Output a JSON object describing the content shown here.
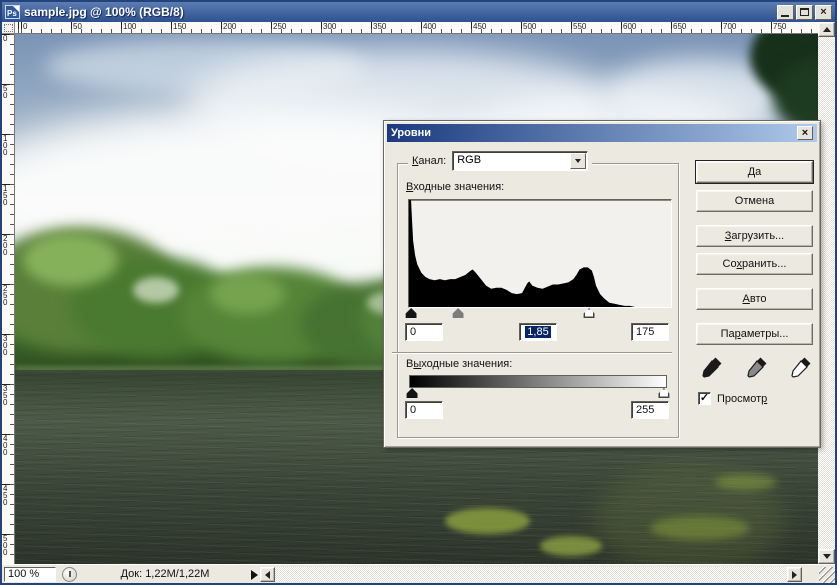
{
  "window": {
    "title": "sample.jpg @ 100% (RGB/8)",
    "app_icon": "photoshop-ps-icon",
    "controls": [
      "minimize",
      "maximize",
      "close"
    ]
  },
  "rulers": {
    "top_labels": [
      "0",
      "50",
      "100",
      "150",
      "200",
      "250",
      "300",
      "350",
      "400",
      "450",
      "500",
      "550",
      "600",
      "650",
      "700",
      "750"
    ],
    "left_labels": [
      "0",
      "50",
      "100",
      "150",
      "200",
      "250",
      "300",
      "350",
      "400",
      "450",
      "500"
    ]
  },
  "dialog": {
    "title": "Уровни",
    "close_label": "×",
    "channel": {
      "label": {
        "text": "Канал:",
        "u": 0
      },
      "value": "RGB"
    },
    "input_section": {
      "label": {
        "text": "Входные значения:",
        "u": 0
      },
      "black": "0",
      "gamma": "1,85",
      "white": "175"
    },
    "output_section": {
      "label": {
        "text": "Выходные значения:",
        "u": 1
      },
      "black": "0",
      "white": "255"
    },
    "sliders": {
      "input_black": 0.012,
      "input_gamma": 0.19,
      "input_white": 0.686,
      "output_black": 0.012,
      "output_white": 0.988
    },
    "histogram": {
      "type": "histogram",
      "channel": "RGB",
      "x_range": [
        0,
        255
      ],
      "points": [
        [
          0,
          100
        ],
        [
          2,
          100
        ],
        [
          3,
          80
        ],
        [
          4,
          62
        ],
        [
          6,
          48
        ],
        [
          8,
          40
        ],
        [
          12,
          32
        ],
        [
          16,
          28
        ],
        [
          20,
          26
        ],
        [
          25,
          25
        ],
        [
          30,
          26
        ],
        [
          35,
          25
        ],
        [
          40,
          26
        ],
        [
          45,
          26
        ],
        [
          50,
          28
        ],
        [
          55,
          30
        ],
        [
          60,
          34
        ],
        [
          62,
          35
        ],
        [
          65,
          32
        ],
        [
          70,
          26
        ],
        [
          75,
          20
        ],
        [
          80,
          17
        ],
        [
          85,
          18
        ],
        [
          90,
          18
        ],
        [
          95,
          16
        ],
        [
          100,
          13
        ],
        [
          105,
          12
        ],
        [
          110,
          13
        ],
        [
          115,
          22
        ],
        [
          117,
          24
        ],
        [
          120,
          20
        ],
        [
          125,
          18
        ],
        [
          130,
          17
        ],
        [
          135,
          19
        ],
        [
          140,
          21
        ],
        [
          145,
          21
        ],
        [
          150,
          22
        ],
        [
          155,
          23
        ],
        [
          160,
          26
        ],
        [
          163,
          30
        ],
        [
          166,
          35
        ],
        [
          170,
          37
        ],
        [
          174,
          37
        ],
        [
          178,
          34
        ],
        [
          180,
          28
        ],
        [
          182,
          20
        ],
        [
          186,
          12
        ],
        [
          190,
          8
        ],
        [
          195,
          4
        ],
        [
          200,
          3
        ],
        [
          205,
          2
        ],
        [
          210,
          1
        ],
        [
          215,
          1
        ],
        [
          220,
          0
        ],
        [
          255,
          0
        ]
      ]
    },
    "buttons": [
      {
        "name": "ok",
        "label": "Да",
        "u": -1,
        "default": true
      },
      {
        "name": "cancel",
        "label": "Отмена",
        "u": -1
      },
      {
        "name": "load",
        "label": "Загрузить...",
        "u": 0
      },
      {
        "name": "save",
        "label": "Сохранить...",
        "u": 2
      },
      {
        "name": "auto",
        "label": "Авто",
        "u": 0
      },
      {
        "name": "options",
        "label": "Параметры...",
        "u": 2
      }
    ],
    "eyedroppers": [
      {
        "name": "black-point-eyedropper",
        "tip": "#1a1a1a"
      },
      {
        "name": "gray-point-eyedropper",
        "tip": "#8a8a8a"
      },
      {
        "name": "white-point-eyedropper",
        "tip": "#ffffff"
      }
    ],
    "preview": {
      "label": {
        "text": "Просмотр",
        "u": 7
      },
      "checked": true,
      "check_glyph": "✓"
    }
  },
  "statusbar": {
    "zoom_value": "100 %",
    "doc_label": "Док: 1,22М/1,22М",
    "menu_icon": "status-popup-icon"
  },
  "colors": {
    "selection_bg": "#0a246a",
    "window_titlebar_top": "#5c7cb2",
    "window_titlebar_bottom": "#2e5190",
    "dialog_titlebar_left": "#1a3a7e",
    "dialog_titlebar_right": "#aec9ea",
    "histogram_fill": "#000000"
  }
}
